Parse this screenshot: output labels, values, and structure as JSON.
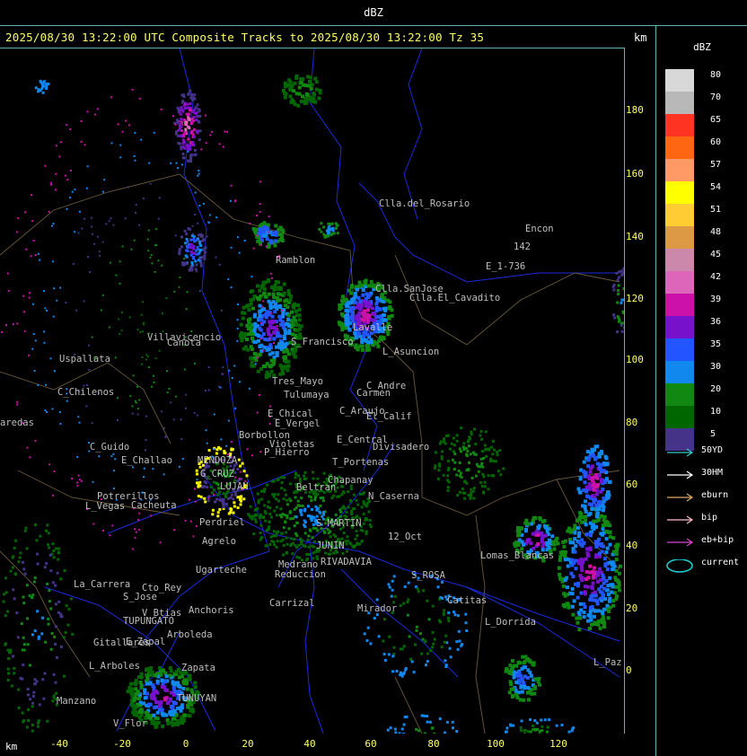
{
  "window": {
    "title": "dBZ"
  },
  "header": {
    "text": "2025/08/30 13:22:00 UTC Composite Tracks to 2025/08/30 13:22:00 Tz 35",
    "km_label": "km"
  },
  "axes": {
    "x_ticks": [
      "-40",
      "-20",
      "0",
      "20",
      "40",
      "60",
      "80",
      "100",
      "120"
    ],
    "y_ticks": [
      "180",
      "160",
      "140",
      "120",
      "100",
      "80",
      "60",
      "40",
      "20",
      "0"
    ],
    "x_unit": "km",
    "y_unit": "km"
  },
  "legend": {
    "title": "dBZ",
    "levels": [
      {
        "label": "80",
        "color": "#d8d8d8"
      },
      {
        "label": "70",
        "color": "#b8b8b8"
      },
      {
        "label": "65",
        "color": "#ff3322"
      },
      {
        "label": "60",
        "color": "#ff6611"
      },
      {
        "label": "57",
        "color": "#ff9966"
      },
      {
        "label": "54",
        "color": "#ffff00"
      },
      {
        "label": "51",
        "color": "#ffcc33"
      },
      {
        "label": "48",
        "color": "#dd9944"
      },
      {
        "label": "45",
        "color": "#cc88aa"
      },
      {
        "label": "42",
        "color": "#dd66bb"
      },
      {
        "label": "39",
        "color": "#cc11aa"
      },
      {
        "label": "36",
        "color": "#7711cc"
      },
      {
        "label": "35",
        "color": "#2255ff"
      },
      {
        "label": "30",
        "color": "#1188ee"
      },
      {
        "label": "20",
        "color": "#118811"
      },
      {
        "label": "10",
        "color": "#006600"
      },
      {
        "label": "5",
        "color": "#443388"
      }
    ],
    "tracks": [
      {
        "label": "50YD",
        "color": "#33cccc",
        "kind": "arrow"
      },
      {
        "label": "30HM",
        "color": "#ffffff",
        "kind": "arrow"
      },
      {
        "label": "eburn",
        "color": "#ddaa66",
        "kind": "arrow"
      },
      {
        "label": "bip",
        "color": "#ffbbcc",
        "kind": "arrow"
      },
      {
        "label": "eb+bip",
        "color": "#dd44cc",
        "kind": "arrow"
      },
      {
        "label": "current",
        "color": "#22cccc",
        "kind": "ellipse"
      }
    ]
  },
  "places": [
    "Clla.del_Rosario",
    "Encon",
    "E_1-736",
    "142",
    "Ramblon",
    "Clla.SanJose",
    "Clla.El_Cavadito",
    "Villavicencio",
    "Uspallata",
    "Canota",
    "S_Francisco",
    "Lavalle",
    "L_Asuncion",
    "C_Chilenos",
    "Tres_Mayo",
    "Tulumaya",
    "C_Andre",
    "Carmen",
    "E_Chical",
    "E_Vergel",
    "C_Araujo",
    "El_Calif",
    "aredas",
    "Borbollon",
    "Violetas",
    "E_Central",
    "Divisadero",
    "C_Guido",
    "P_Hierro",
    "E_Challao",
    "LUJAN",
    "T_Portenas",
    "Chapanay",
    "MENDOZA",
    "G_CRUZ",
    "Potrerillos",
    "Cacheuta",
    "L_Vegas",
    "Beltran",
    "N_Caserna",
    "Perdriel",
    "S_MARTIN",
    "Agrelo",
    "Ugarteche",
    "JUNIN",
    "12_Oct",
    "RIVADAVIA",
    "Lomas_Blancas",
    "S_ROSA",
    "La_Carrera",
    "Reduccion",
    "Medrano",
    "Cto_Rey",
    "S_Jose",
    "Anchoris",
    "Carrizal",
    "Catitas",
    "V_Btias",
    "TUPUNGATO",
    "Mirador",
    "L_Dorrida",
    "Arboleda",
    "Gitallares",
    "E_Zapal",
    "L_Paz",
    "L_Arboles",
    "Zapata",
    "TUNUYAN",
    "Manzano",
    "V_Flor"
  ]
}
